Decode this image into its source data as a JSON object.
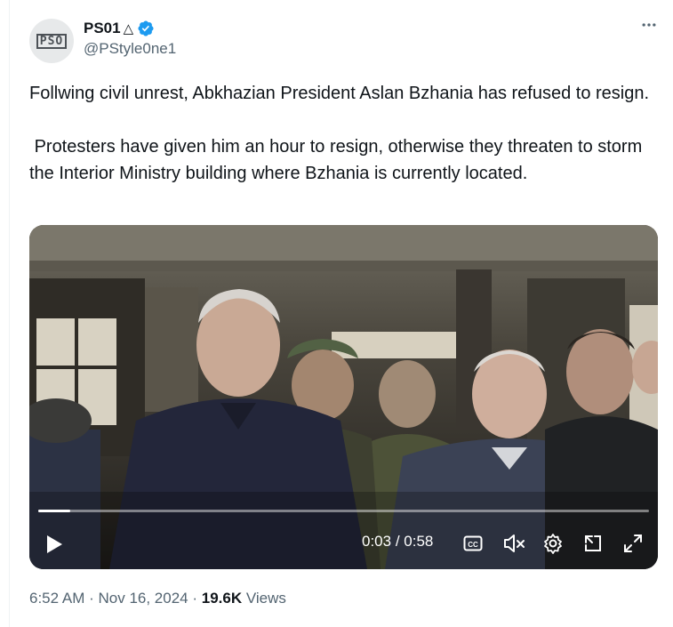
{
  "author": {
    "display_name": "PS01",
    "name_suffix": "△",
    "handle": "@PStyle0ne1",
    "avatar_text": "PSO"
  },
  "tweet": {
    "paragraphs": [
      "Follwing civil unrest, Abkhazian President Aslan Bzhania has refused to resign.",
      " Protesters have given him an hour to resign, otherwise they threaten to storm the Interior Ministry building where Bzhania is currently located."
    ]
  },
  "video": {
    "current_time": "0:03",
    "separator": " / ",
    "duration": "0:58",
    "progress_fraction": 0.052
  },
  "meta": {
    "time": "6:52 AM",
    "dot": " · ",
    "date": "Nov 16, 2024",
    "views_count": "19.6K",
    "views_label": "Views"
  },
  "colors": {
    "verified": "#1d9bf0",
    "secondary_text": "#536471",
    "primary_text": "#0f1419"
  },
  "icons": [
    "verified-icon",
    "more-icon",
    "play-icon",
    "captions-icon",
    "mute-icon",
    "settings-icon",
    "pip-icon",
    "fullscreen-icon"
  ]
}
